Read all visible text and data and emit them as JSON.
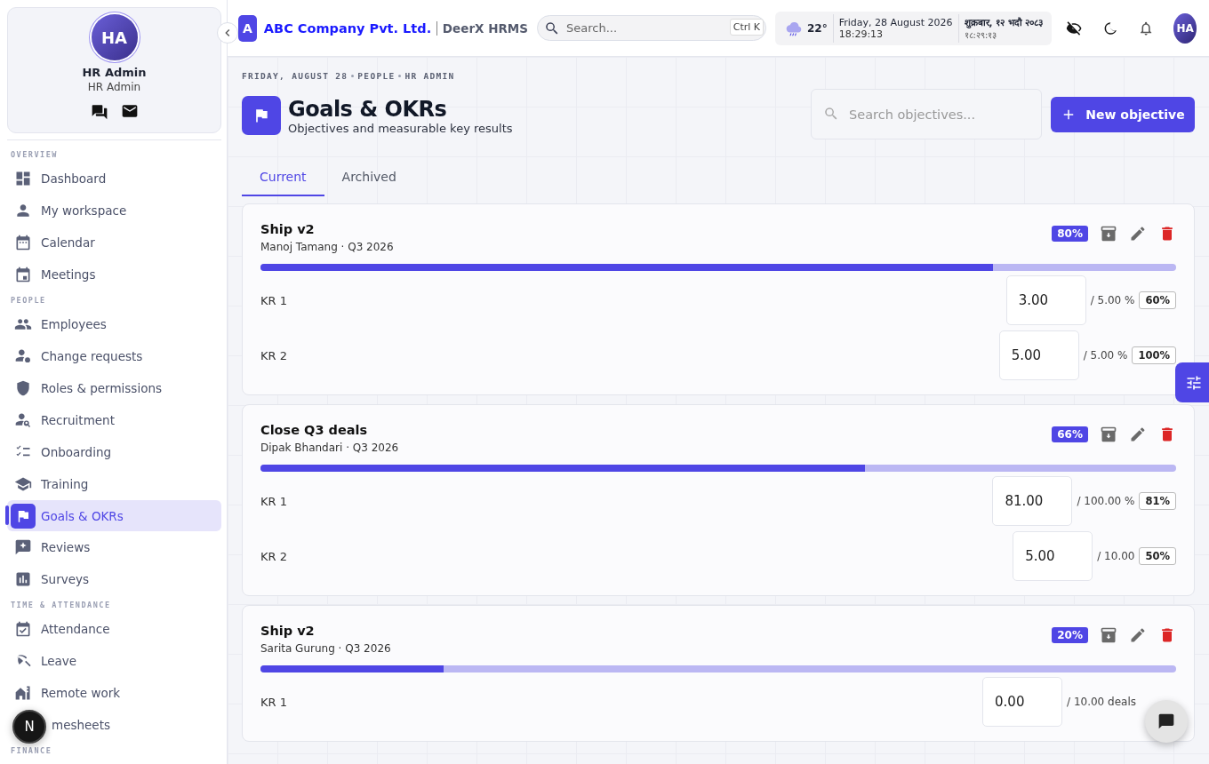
{
  "profile": {
    "initials": "HA",
    "name": "HR Admin",
    "role": "HR Admin"
  },
  "sidebar": {
    "sections": [
      {
        "label": "OVERVIEW",
        "items": [
          {
            "label": "Dashboard",
            "selected": false
          },
          {
            "label": "My workspace",
            "selected": false
          },
          {
            "label": "Calendar",
            "selected": false
          },
          {
            "label": "Meetings",
            "selected": false
          }
        ]
      },
      {
        "label": "PEOPLE",
        "items": [
          {
            "label": "Employees",
            "selected": false
          },
          {
            "label": "Change requests",
            "selected": false
          },
          {
            "label": "Roles & permissions",
            "selected": false
          },
          {
            "label": "Recruitment",
            "selected": false
          },
          {
            "label": "Onboarding",
            "selected": false
          },
          {
            "label": "Training",
            "selected": false
          },
          {
            "label": "Goals & OKRs",
            "selected": true
          },
          {
            "label": "Reviews",
            "selected": false
          },
          {
            "label": "Surveys",
            "selected": false
          }
        ]
      },
      {
        "label": "TIME & ATTENDANCE",
        "items": [
          {
            "label": "Attendance",
            "selected": false
          },
          {
            "label": "Leave",
            "selected": false
          },
          {
            "label": "Remote work",
            "selected": false
          },
          {
            "label": "mesheets",
            "selected": false
          }
        ]
      },
      {
        "label": "FINANCE"
      }
    ]
  },
  "floating_button": {
    "label": "N"
  },
  "topbar": {
    "logo_letter": "A",
    "company": "ABC Company Pvt. Ltd.",
    "product": "DeerX HRMS",
    "search": {
      "placeholder": "Search...",
      "shortcut": "Ctrl K"
    },
    "weather": {
      "temperature": "22°"
    },
    "date": "Friday, 28 August 2026",
    "time": "18:29:13",
    "nepali_date": "शुक्रबार, १२ भदौ २०८३",
    "nepali_time": "१८:२९:१३",
    "avatar": "HA"
  },
  "page": {
    "breadcrumbs": [
      "FRIDAY, AUGUST 28",
      "PEOPLE",
      "HR ADMIN"
    ],
    "title": "Goals & OKRs",
    "subtitle": "Objectives and measurable key results",
    "search": {
      "placeholder": "Search objectives..."
    },
    "new_button": "New objective",
    "tabs": [
      {
        "label": "Current",
        "selected": true
      },
      {
        "label": "Archived",
        "selected": false
      }
    ],
    "objectives": [
      {
        "title": "Ship v2",
        "meta": "Manoj Tamang · Q3 2026",
        "percent": "80%",
        "level": 0.8,
        "key_results": [
          {
            "label": "KR 1",
            "value": "3.00",
            "target": "/ 5.00 %",
            "percent": "60%"
          },
          {
            "label": "KR 2",
            "value": "5.00",
            "target": "/ 5.00 %",
            "percent": "100%"
          }
        ]
      },
      {
        "title": "Close Q3 deals",
        "meta": "Dipak Bhandari · Q3 2026",
        "percent": "66%",
        "level": 0.66,
        "key_results": [
          {
            "label": "KR 1",
            "value": "81.00",
            "target": "/ 100.00 %",
            "percent": "81%"
          },
          {
            "label": "KR 2",
            "value": "5.00",
            "target": "/ 10.00",
            "percent": "50%"
          }
        ]
      },
      {
        "title": "Ship v2",
        "meta": "Sarita Gurung · Q3 2026",
        "percent": "20%",
        "level": 0.2,
        "key_results": [
          {
            "label": "KR 1",
            "value": "0.00",
            "target": "/ 10.00 deals"
          }
        ]
      }
    ]
  }
}
